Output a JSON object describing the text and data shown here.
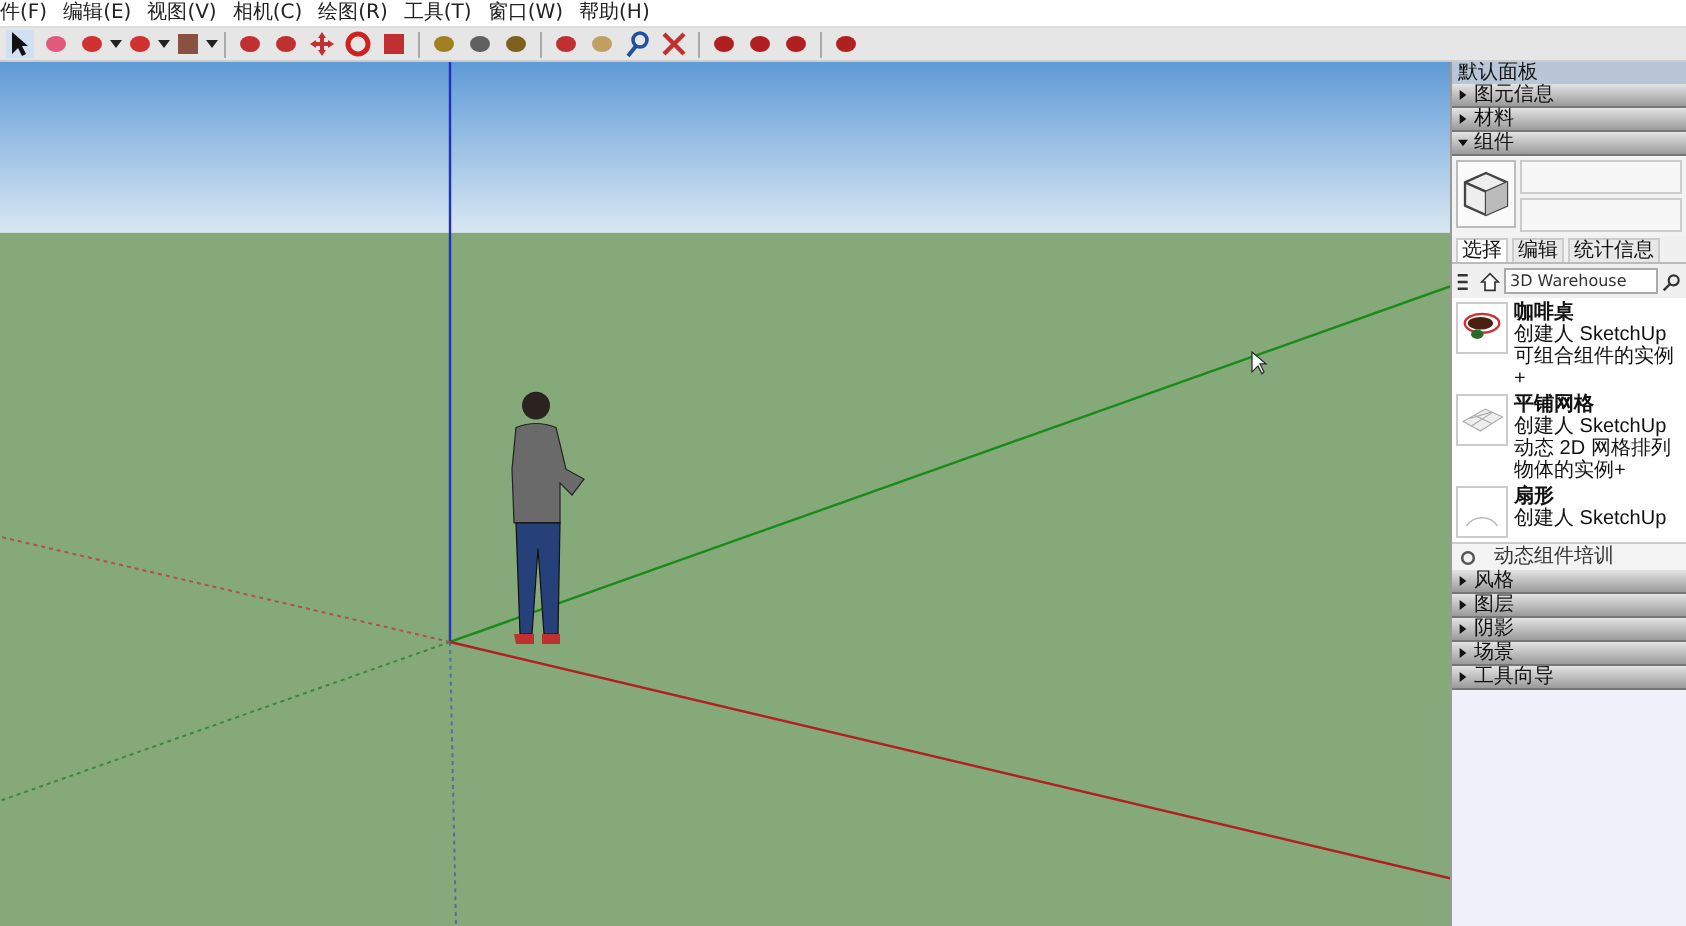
{
  "menu": [
    {
      "label": "件(F)"
    },
    {
      "label": "编辑(E)"
    },
    {
      "label": "视图(V)"
    },
    {
      "label": "相机(C)"
    },
    {
      "label": "绘图(R)"
    },
    {
      "label": "工具(T)"
    },
    {
      "label": "窗口(W)"
    },
    {
      "label": "帮助(H)"
    }
  ],
  "panel": {
    "title": "默认面板",
    "sections_top": [
      {
        "label": "图元信息",
        "expanded": false
      },
      {
        "label": "材料",
        "expanded": false
      },
      {
        "label": "组件",
        "expanded": true
      }
    ],
    "tabs": [
      {
        "label": "选择",
        "selected": true
      },
      {
        "label": "编辑",
        "selected": false
      },
      {
        "label": "统计信息",
        "selected": false
      }
    ],
    "search": {
      "value": "3D Warehouse"
    },
    "components": [
      {
        "name": "咖啡桌",
        "author": "创建人 SketchUp",
        "description": "可组合组件的实例+"
      },
      {
        "name": "平铺网格",
        "author": "创建人 SketchUp",
        "description": "动态 2D 网格排列物体的实例+"
      },
      {
        "name": "扇形",
        "author": "创建人 SketchUp"
      }
    ],
    "footer": "动态组件培训",
    "sections_bottom": [
      {
        "label": "风格",
        "expanded": false
      },
      {
        "label": "图层",
        "expanded": false
      },
      {
        "label": "阴影",
        "expanded": false
      },
      {
        "label": "场景",
        "expanded": false
      },
      {
        "label": "工具向导",
        "expanded": false
      }
    ]
  }
}
